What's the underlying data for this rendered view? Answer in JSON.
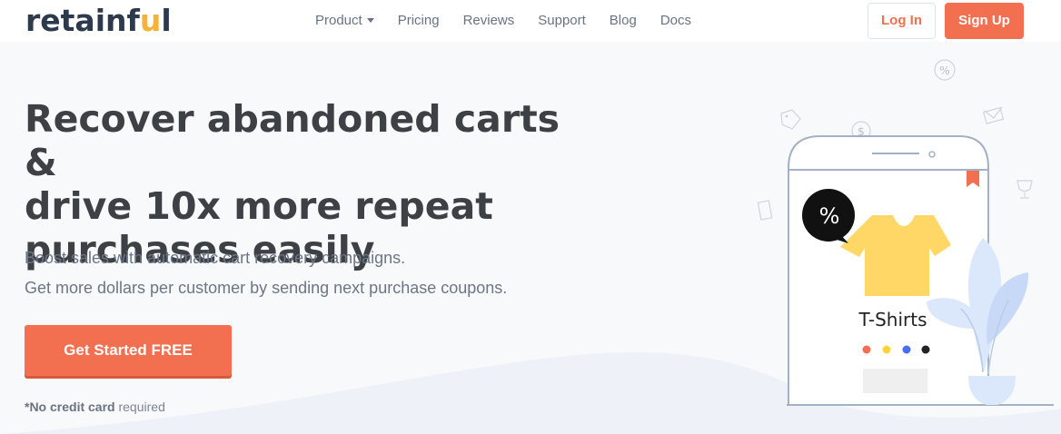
{
  "brand": {
    "logo_start": "retainf",
    "logo_accent": "u",
    "logo_end": "l",
    "accent_color": "#f26f4f",
    "logo_accent_color": "#f5b335"
  },
  "nav": {
    "items": [
      {
        "label": "Product",
        "has_dropdown": true
      },
      {
        "label": "Pricing"
      },
      {
        "label": "Reviews"
      },
      {
        "label": "Support"
      },
      {
        "label": "Blog"
      },
      {
        "label": "Docs"
      }
    ],
    "login_label": "Log In",
    "signup_label": "Sign Up"
  },
  "hero": {
    "title_line1": "Recover abandoned carts &",
    "title_line2": "drive 10x more repeat",
    "title_line3": "purchases easily",
    "subtitle1": "Boost sales with automatic cart recovery campaigns.",
    "subtitle2": "Get more dollars per customer by sending next purchase coupons.",
    "cta_label": "Get Started FREE",
    "note_bold": "*No credit card",
    "note_rest": " required"
  },
  "illustration": {
    "badge_text": "%",
    "product_label": "T-Shirts",
    "tshirt_color": "#ffd766",
    "color_swatches": [
      "#f26f4f",
      "#ffd43b",
      "#4a6cf0",
      "#222222"
    ],
    "icons": [
      "percent-icon",
      "tag-icon",
      "dollar-icon",
      "mail-icon",
      "trophy-icon",
      "ticket-icon"
    ]
  }
}
